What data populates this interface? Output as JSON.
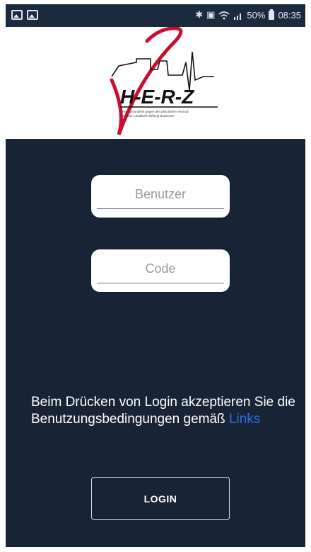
{
  "status_bar": {
    "battery_percent": "50%",
    "time": "08:35",
    "icons": [
      "image-icon",
      "gallery-icon",
      "bluetooth-icon",
      "vibrate-icon",
      "wifi-icon",
      "signal-icon",
      "battery-icon"
    ]
  },
  "header": {
    "logo_text": "H-E-R-Z",
    "logo_subtitle_1": "Herzgesundheit gegen den plötzlichen Herztod",
    "logo_subtitle_2": "in einer Landkreis-Stiftung Bodensee"
  },
  "form": {
    "user_placeholder": "Benutzer",
    "user_value": "",
    "code_placeholder": "Code",
    "code_value": "",
    "terms_text": "Beim Drücken von Login akzeptieren Sie die Benutzungsbedingungen gemäß",
    "terms_link": "Links",
    "login_label": "LOGIN"
  },
  "colors": {
    "background": "#182436",
    "link": "#2f6cf0",
    "logo_red": "#c8102e"
  }
}
